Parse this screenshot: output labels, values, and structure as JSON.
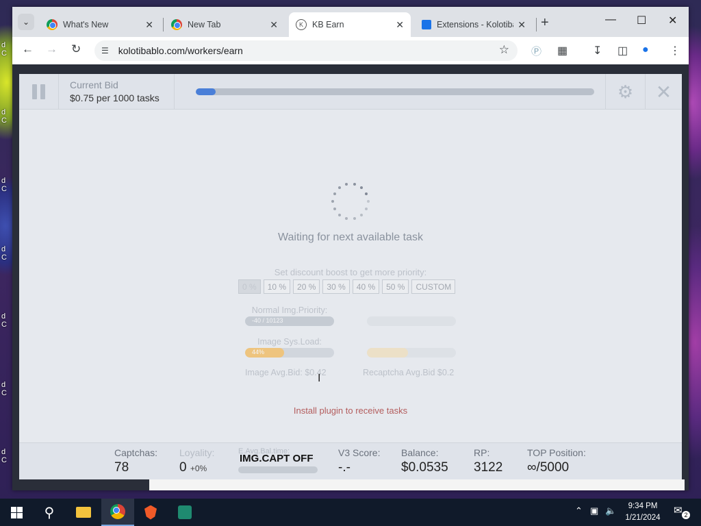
{
  "tabs": [
    {
      "label": "What's New",
      "icon": "chrome-icon"
    },
    {
      "label": "New Tab",
      "icon": "chrome-icon"
    },
    {
      "label": "KB Earn",
      "icon": "kolotibablo-icon"
    },
    {
      "label": "Extensions - Kolotiba",
      "icon": "puzzle-icon"
    }
  ],
  "address_bar": {
    "url": "kolotibablo.com/workers/earn"
  },
  "worker": {
    "current_bid_label": "Current Bid",
    "current_bid_value": "$0.75 per 1000 tasks",
    "progress_fraction": 0.05,
    "waiting_text": "Waiting for next available task",
    "discount_title": "Set discount boost to get more priority:",
    "discount_options": [
      "0 %",
      "10 %",
      "20 %",
      "30 %",
      "40 %",
      "50 %",
      "CUSTOM"
    ],
    "discount_selected": "0 %",
    "normal_priority_label": "Normal Img.Priority:",
    "normal_priority_value": "-40 / 10123",
    "sys_load_label": "Image Sys.Load:",
    "sys_load_value": "44%",
    "sys_load_fraction": 0.44,
    "image_avg_bid": "Image Avg.Bid: $0.42",
    "recaptcha_avg_bid": "Recaptcha Avg.Bid $0.2",
    "install_link": "Install plugin to receive tasks"
  },
  "stats": {
    "captchas_label": "Captchas:",
    "captchas_value": "78",
    "loyality_label": "Loyality:",
    "loyality_value": "0",
    "loyality_delta": "+0%",
    "img_capt_status": "IMG.CAPT OFF",
    "e_avg_label": "E.Avg.Bal.time:",
    "v3_label": "V3 Score:",
    "v3_value": "-.-",
    "balance_label": "Balance:",
    "balance_value": "$0.0535",
    "rp_label": "RP:",
    "rp_value": "3122",
    "top_label": "TOP Position:",
    "top_value": "∞/5000"
  },
  "taskbar": {
    "time": "9:34 PM",
    "date": "1/21/2024",
    "notification_count": "2"
  },
  "colors": {
    "accent_progress": "#4a7fd8",
    "sys_load_fill": "#f5a623",
    "install_link": "#b35c5c"
  }
}
